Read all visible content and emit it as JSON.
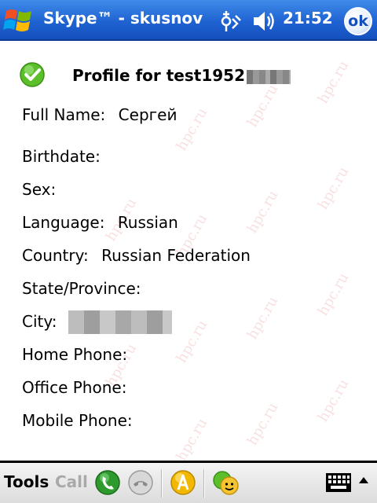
{
  "titlebar": {
    "title": "Skype™ - skusnov",
    "clock": "21:52",
    "ok_label": "ok"
  },
  "profile": {
    "title": "Profile for test1952",
    "fields": [
      {
        "label": "Full Name:",
        "value": "Сергей"
      },
      {
        "label": "Birthdate:",
        "value": ""
      },
      {
        "label": "Sex:",
        "value": ""
      },
      {
        "label": "Language:",
        "value": "Russian"
      },
      {
        "label": "Country:",
        "value": "Russian Federation"
      },
      {
        "label": "State/Province:",
        "value": ""
      },
      {
        "label": "City:",
        "value": ""
      },
      {
        "label": "Home Phone:",
        "value": ""
      },
      {
        "label": "Office Phone:",
        "value": ""
      },
      {
        "label": "Mobile Phone:",
        "value": ""
      }
    ]
  },
  "watermark": "hpc.ru",
  "toolbar": {
    "tools_label": "Tools",
    "call_label": "Call"
  },
  "colors": {
    "titlebar": "#1f63d2",
    "online": "#5bbf2a"
  }
}
